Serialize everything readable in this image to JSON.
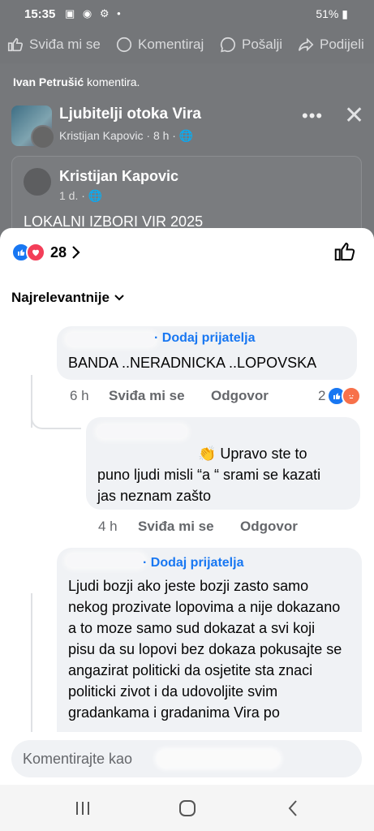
{
  "status_bar": {
    "time": "15:35",
    "battery": "51%",
    "left_icons": "▣ ◉ ⚙ •",
    "right_icons": "🔇 ◉ ..▏..▏"
  },
  "post_actions": [
    {
      "label": "Sviđa mi se",
      "icon": "thumbs-up-icon"
    },
    {
      "label": "Komentiraj",
      "icon": "comment-icon"
    },
    {
      "label": "Pošalji",
      "icon": "messenger-icon"
    },
    {
      "label": "Podijeli",
      "icon": "share-icon"
    }
  ],
  "background_post": {
    "commented_by": "Ivan Petrušić",
    "commented_suffix": " komentira.",
    "group_name": "Ljubitelji otoka Vira",
    "group_sub_author": "Kristijan Kapovic",
    "group_sub_time": " · 8 h · ",
    "author": "Kristijan Kapovic",
    "time": "1 d. · ",
    "text": "LOKALNI IZBORI VIR 2025"
  },
  "sheet": {
    "reaction_count": "28",
    "sort_label": "Najrelevantnije"
  },
  "comments": [
    {
      "add_friend": "· Dodaj prijatelja",
      "text": "BANDA ..NERADNICKA ..LOPOVSKA",
      "time": "6 h",
      "like": "Sviđa mi se",
      "reply": "Odgovor",
      "reactions": "2"
    },
    {
      "text_prefix": "👏 Upravo ste to",
      "text_rest": "puno ljudi misli “a “ srami se kazati  jas neznam zašto",
      "time": "4 h",
      "like": "Sviđa mi se",
      "reply": "Odgovor"
    },
    {
      "add_friend": "· Dodaj prijatelja",
      "text": "Ljudi bozji ako jeste bozji zasto samo nekog prozivate lopovima a nije dokazano a to moze samo sud dokazat a svi koji pisu  da su lopovi bez dokaza pokusajte se angazirat politicki da osjetite sta znaci politicki zivot i da udovoljite svim gradankama i gradanima Vira po"
    }
  ],
  "composer": {
    "placeholder": "Komentirajte kao"
  },
  "colors": {
    "brand_blue": "#1877f2",
    "love_red": "#f33e58",
    "angry_orange": "#f7714a"
  }
}
